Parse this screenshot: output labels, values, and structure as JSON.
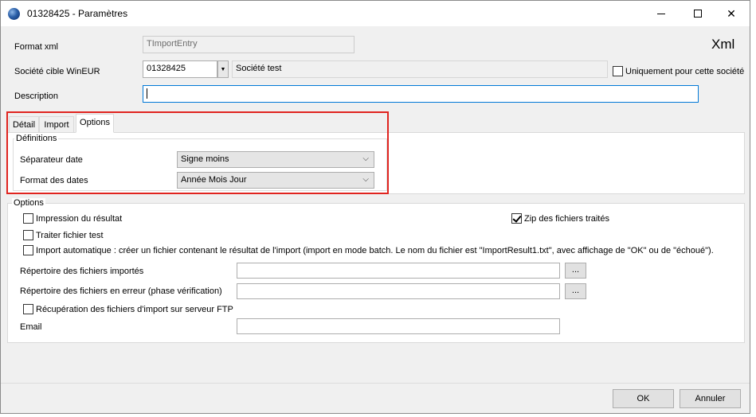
{
  "window": {
    "title": "01328425 - Paramètres",
    "controls": {
      "minimize": "—",
      "maximize": "",
      "close": "✕"
    }
  },
  "header": {
    "format_xml_label": "Format xml",
    "format_xml_value": "TImportEntry",
    "xml_badge": "Xml",
    "societe_label": "Société cible WinEUR",
    "societe_code": "01328425",
    "societe_name": "Société test",
    "dropdown_arrow": "▼",
    "uniquement_label": "Uniquement pour cette société",
    "description_label": "Description",
    "description_value": ""
  },
  "tabs": [
    {
      "label": "Détail"
    },
    {
      "label": "Import"
    },
    {
      "label": "Options"
    }
  ],
  "definitions": {
    "title": "Définitions",
    "separateur_label": "Séparateur date",
    "separateur_value": "Signe moins",
    "format_label": "Format des dates",
    "format_value": "Année Mois Jour",
    "chevron": "⌵"
  },
  "options": {
    "title": "Options",
    "impression_label": "Impression du résultat",
    "zip_label": "Zip des fichiers traités",
    "zip_checked": true,
    "traiter_label": "Traiter fichier test",
    "import_auto_label": "Import automatique : créer un fichier contenant le résultat de l'import (import en mode batch. Le nom du fichier est \"ImportResult1.txt\", avec affichage de \"OK\" ou de \"échoué\").",
    "rep_importes_label": "Répertoire des fichiers importés",
    "rep_erreur_label": "Répertoire des fichiers en erreur (phase vérification)",
    "browse_label": "...",
    "ftp_label": "Récupération des fichiers d'import sur serveur FTP",
    "email_label": "Email"
  },
  "footer": {
    "ok_label": "OK",
    "cancel_label": "Annuler"
  },
  "colors": {
    "highlight": "#e0241f",
    "focus": "#0078d7",
    "window_bg": "#f0f0f0"
  }
}
